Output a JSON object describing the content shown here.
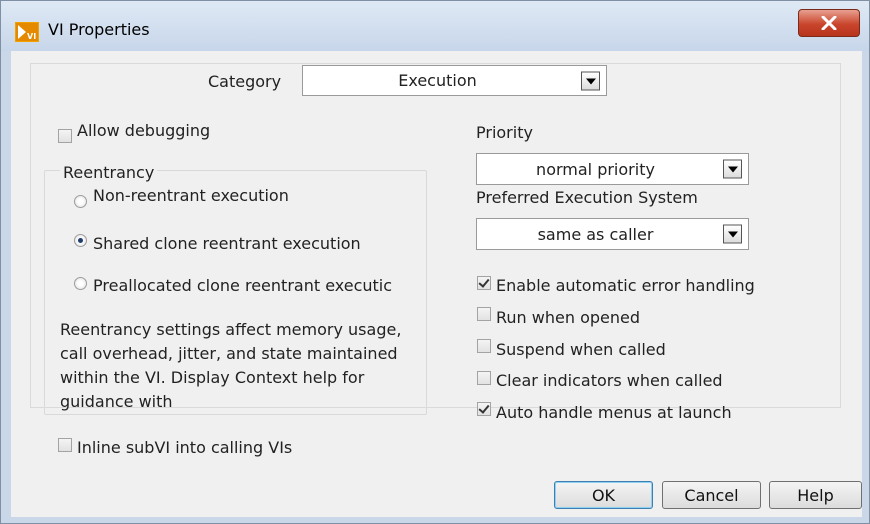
{
  "window": {
    "title": "VI Properties"
  },
  "category": {
    "label": "Category",
    "value": "Execution"
  },
  "left": {
    "allow_debugging": {
      "label": "Allow debugging",
      "checked": false
    },
    "reentrancy": {
      "title": "Reentrancy",
      "options": [
        {
          "label": "Non-reentrant execution",
          "selected": false
        },
        {
          "label": "Shared clone reentrant execution",
          "selected": true
        },
        {
          "label": "Preallocated clone reentrant executic",
          "selected": false
        }
      ],
      "description": "Reentrancy settings affect memory usage, call overhead, jitter, and state maintained within the VI. Display Context help for guidance with"
    },
    "inline_subvi": {
      "label": "Inline subVI into calling VIs",
      "checked": false
    }
  },
  "right": {
    "priority": {
      "label": "Priority",
      "value": "normal priority"
    },
    "execution_system": {
      "label": "Preferred Execution System",
      "value": "same as caller"
    },
    "checkboxes": [
      {
        "label": "Enable automatic error handling",
        "checked": true
      },
      {
        "label": "Run when opened",
        "checked": false
      },
      {
        "label": "Suspend when called",
        "checked": false
      },
      {
        "label": "Clear indicators when called",
        "checked": false
      },
      {
        "label": "Auto handle menus at launch",
        "checked": true
      }
    ]
  },
  "buttons": {
    "ok": "OK",
    "cancel": "Cancel",
    "help": "Help"
  },
  "icons": {
    "app": "labview-vi-icon",
    "close": "close-icon",
    "dropdown": "dropdown-arrow-icon"
  },
  "colors": {
    "close_button": "#c9452c",
    "title_bar": "#c7d6ea",
    "dialog_bg": "#f0f0f0"
  }
}
